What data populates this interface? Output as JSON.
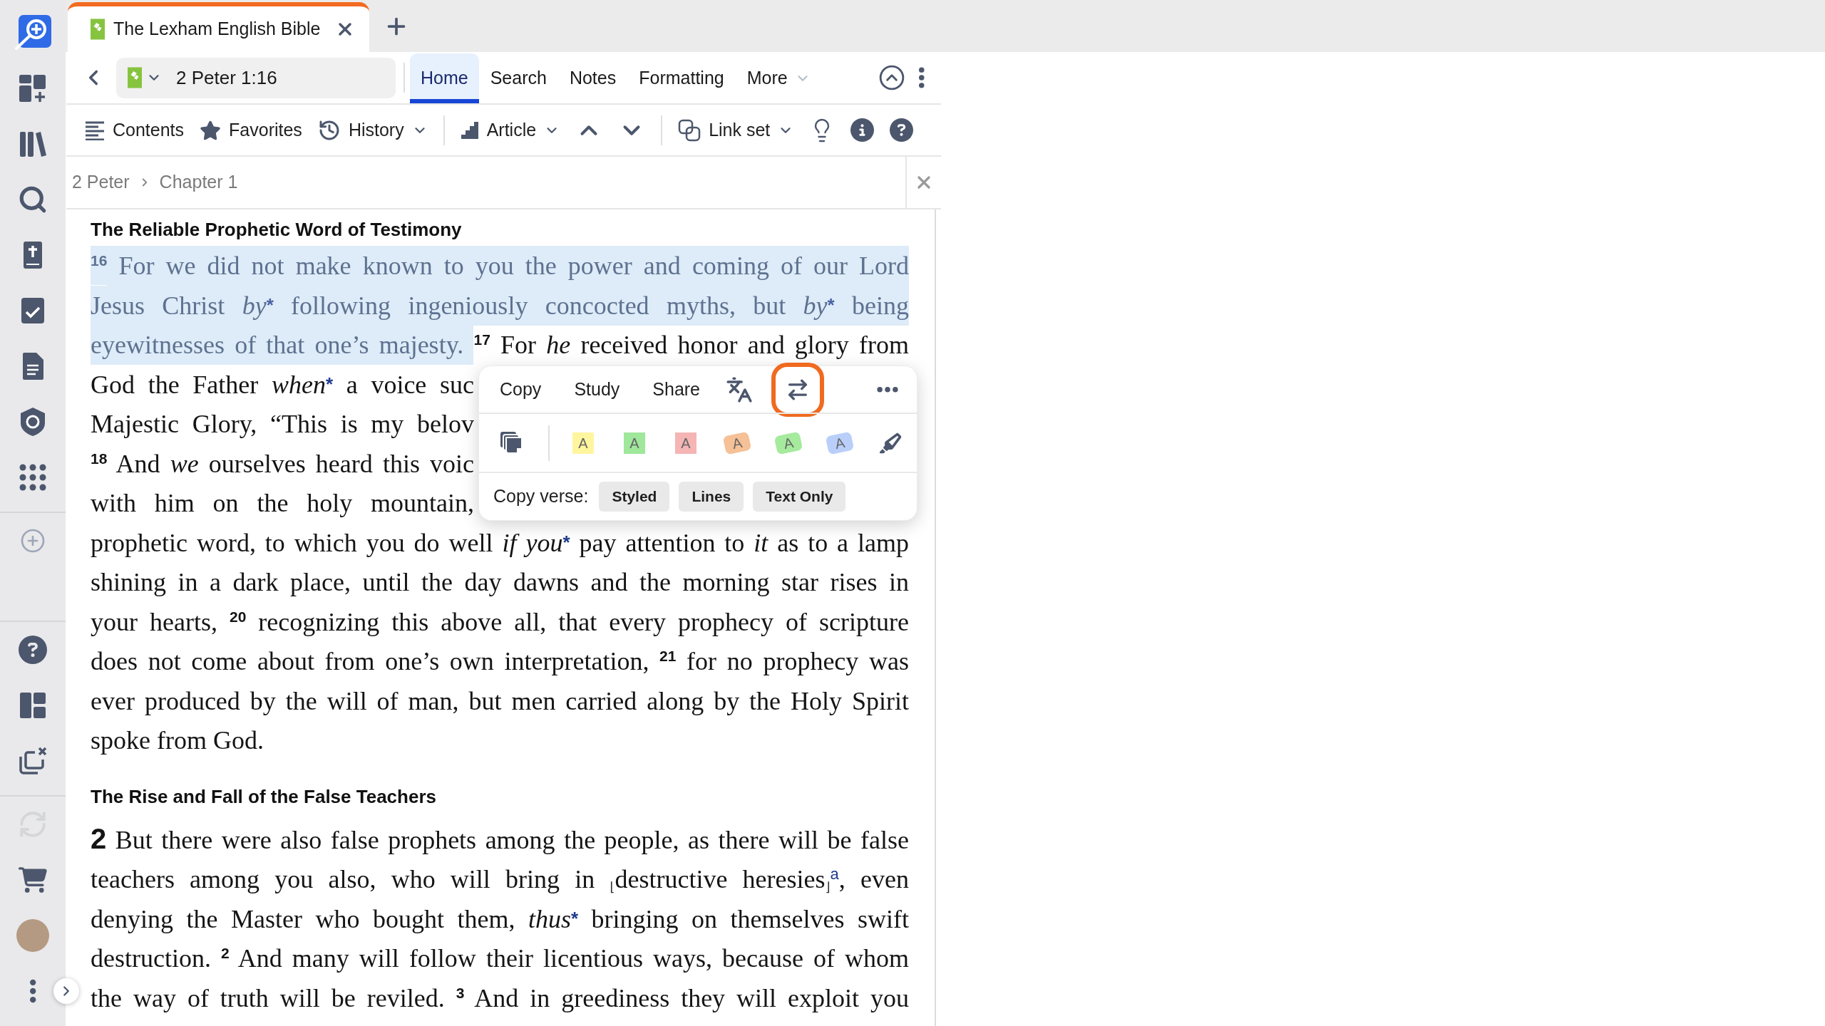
{
  "sidebar": {
    "groups": [
      {
        "items": [
          {
            "kind": "logo",
            "disabled": false
          },
          {
            "kind": "dashboard",
            "disabled": false
          },
          {
            "kind": "library",
            "disabled": false
          },
          {
            "kind": "search",
            "disabled": false
          },
          {
            "kind": "bible",
            "disabled": false
          },
          {
            "kind": "checklist",
            "disabled": false
          },
          {
            "kind": "document",
            "disabled": false
          },
          {
            "kind": "badge",
            "disabled": false
          },
          {
            "kind": "apps",
            "disabled": false
          }
        ]
      },
      {
        "items": [
          {
            "kind": "add",
            "disabled": false
          }
        ]
      },
      {
        "items": [
          {
            "kind": "help",
            "disabled": false
          },
          {
            "kind": "layout",
            "disabled": false
          },
          {
            "kind": "close_windows",
            "disabled": false
          }
        ]
      },
      {
        "items": [
          {
            "kind": "sync",
            "disabled": true
          },
          {
            "kind": "cart",
            "disabled": false
          },
          {
            "kind": "avatar",
            "disabled": false
          },
          {
            "kind": "more",
            "disabled": false
          }
        ]
      }
    ]
  },
  "tabs": [
    {
      "title": "The Lexham English Bible",
      "selected": true
    }
  ],
  "panel": {
    "reference": "2 Peter 1:16",
    "ribbon": [
      {
        "label": "Home",
        "selected": true,
        "has_menu": false
      },
      {
        "label": "Search",
        "selected": false,
        "has_menu": false
      },
      {
        "label": "Notes",
        "selected": false,
        "has_menu": false
      },
      {
        "label": "Formatting",
        "selected": false,
        "has_menu": false
      },
      {
        "label": "More",
        "selected": false,
        "has_menu": true
      }
    ],
    "toolbar": [
      {
        "kind": "contents",
        "label": "Contents",
        "has_menu": false
      },
      {
        "kind": "favorites",
        "label": "Favorites",
        "has_menu": false
      },
      {
        "kind": "history",
        "label": "History",
        "has_menu": true
      },
      {
        "kind": "divider"
      },
      {
        "kind": "article",
        "label": "Article",
        "has_menu": true
      },
      {
        "kind": "previous"
      },
      {
        "kind": "next"
      },
      {
        "kind": "divider"
      },
      {
        "kind": "link_set",
        "label": "Link set",
        "has_menu": true
      },
      {
        "kind": "insights"
      },
      {
        "kind": "info"
      },
      {
        "kind": "help"
      }
    ],
    "breadcrumb": [
      "2 Peter",
      "Chapter 1"
    ],
    "passage": {
      "sections": [
        {
          "heading": "The Reliable Prophetic Word of Testimony",
          "lines": [
            {
              "justified": true,
              "covered": false,
              "segments": [
                {
                  "kind": "verse",
                  "text": "16",
                  "selected": true
                },
                {
                  "kind": "text",
                  "text": " For we did not make known to you the power and coming of our Lord",
                  "selected": true
                }
              ]
            },
            {
              "justified": true,
              "covered": false,
              "segments": [
                {
                  "kind": "text",
                  "text": "Jesus Christ ",
                  "selected": true
                },
                {
                  "kind": "italic",
                  "text": "by",
                  "selected": true
                },
                {
                  "kind": "mark",
                  "text": "*",
                  "selected": true
                },
                {
                  "kind": "text",
                  "text": " following ingeniously concocted myths, but ",
                  "selected": true
                },
                {
                  "kind": "italic",
                  "text": "by",
                  "selected": true
                },
                {
                  "kind": "mark",
                  "text": "*",
                  "selected": true
                },
                {
                  "kind": "text",
                  "text": " being",
                  "selected": true
                }
              ]
            },
            {
              "justified": true,
              "covered": false,
              "segments": [
                {
                  "kind": "text",
                  "text": "eyewitnesses of that one’s majesty. ",
                  "selected": true
                },
                {
                  "kind": "verse",
                  "text": "17",
                  "selected": false
                },
                {
                  "kind": "text",
                  "text": " For ",
                  "selected": false
                },
                {
                  "kind": "italic",
                  "text": "he",
                  "selected": false
                },
                {
                  "kind": "text",
                  "text": " received honor and glory from",
                  "selected": false
                }
              ]
            },
            {
              "justified": true,
              "covered": true,
              "segments": [
                {
                  "kind": "text",
                  "text": "God the Father ",
                  "selected": false
                },
                {
                  "kind": "italic",
                  "text": "when",
                  "selected": false
                },
                {
                  "kind": "mark",
                  "text": "*",
                  "selected": false
                },
                {
                  "kind": "text",
                  "text": " a voice suc",
                  "selected": false
                }
              ]
            },
            {
              "justified": true,
              "covered": true,
              "segments": [
                {
                  "kind": "text",
                  "text": "Majestic Glory, “This is my belov",
                  "selected": false
                }
              ]
            },
            {
              "justified": true,
              "covered": true,
              "segments": [
                {
                  "kind": "verse",
                  "text": "18",
                  "selected": false
                },
                {
                  "kind": "text",
                  "text": " And ",
                  "selected": false
                },
                {
                  "kind": "italic",
                  "text": "we",
                  "selected": false
                },
                {
                  "kind": "text",
                  "text": " ourselves heard this voic",
                  "selected": false
                }
              ]
            },
            {
              "justified": true,
              "covered": true,
              "segments": [
                {
                  "kind": "text",
                  "text": "with him on the holy mountain,",
                  "selected": false
                }
              ]
            },
            {
              "justified": true,
              "covered": false,
              "segments": [
                {
                  "kind": "text",
                  "text": "prophetic word, to which you do well ",
                  "selected": false
                },
                {
                  "kind": "italic",
                  "text": "if you",
                  "selected": false
                },
                {
                  "kind": "mark",
                  "text": "*",
                  "selected": false
                },
                {
                  "kind": "text",
                  "text": " pay attention to ",
                  "selected": false
                },
                {
                  "kind": "italic",
                  "text": "it",
                  "selected": false
                },
                {
                  "kind": "text",
                  "text": " as to a lamp",
                  "selected": false
                }
              ]
            },
            {
              "justified": true,
              "covered": false,
              "segments": [
                {
                  "kind": "text",
                  "text": "shining in a dark place, until the day dawns and the morning star rises in",
                  "selected": false
                }
              ]
            },
            {
              "justified": true,
              "covered": false,
              "segments": [
                {
                  "kind": "text",
                  "text": "your hearts, ",
                  "selected": false
                },
                {
                  "kind": "verse",
                  "text": "20",
                  "selected": false
                },
                {
                  "kind": "text",
                  "text": " recognizing this above all, that every prophecy of scripture",
                  "selected": false
                }
              ]
            },
            {
              "justified": true,
              "covered": false,
              "segments": [
                {
                  "kind": "text",
                  "text": "does not come about from one’s own interpretation, ",
                  "selected": false
                },
                {
                  "kind": "verse",
                  "text": "21",
                  "selected": false
                },
                {
                  "kind": "text",
                  "text": " for no prophecy was",
                  "selected": false
                }
              ]
            },
            {
              "justified": true,
              "covered": false,
              "segments": [
                {
                  "kind": "text",
                  "text": "ever produced by the will of man, but men carried along by the Holy Spirit",
                  "selected": false
                }
              ]
            },
            {
              "justified": false,
              "covered": false,
              "segments": [
                {
                  "kind": "text",
                  "text": "spoke from God.",
                  "selected": false
                }
              ]
            }
          ]
        },
        {
          "heading": "The Rise and Fall of the False Teachers",
          "lines": [
            {
              "justified": true,
              "covered": false,
              "segments": [
                {
                  "kind": "chapter",
                  "text": "2",
                  "selected": false
                },
                {
                  "kind": "text",
                  "text": " But there were also false prophets among the people, as there will be false",
                  "selected": false
                }
              ]
            },
            {
              "justified": true,
              "covered": false,
              "segments": [
                {
                  "kind": "text",
                  "text": "teachers among you also, who will bring in ",
                  "selected": false
                },
                {
                  "kind": "bracket",
                  "text": "⌊",
                  "selected": false
                },
                {
                  "kind": "text",
                  "text": "destructive heresies",
                  "selected": false
                },
                {
                  "kind": "bracket",
                  "text": "⌋",
                  "selected": false
                },
                {
                  "kind": "footnote",
                  "text": "a",
                  "selected": false
                },
                {
                  "kind": "text",
                  "text": ", even",
                  "selected": false
                }
              ]
            },
            {
              "justified": true,
              "covered": false,
              "segments": [
                {
                  "kind": "text",
                  "text": "denying the Master who bought them, ",
                  "selected": false
                },
                {
                  "kind": "italic",
                  "text": "thus",
                  "selected": false
                },
                {
                  "kind": "mark",
                  "text": "*",
                  "selected": false
                },
                {
                  "kind": "text",
                  "text": " bringing on themselves swift",
                  "selected": false
                }
              ]
            },
            {
              "justified": true,
              "covered": false,
              "segments": [
                {
                  "kind": "text",
                  "text": "destruction. ",
                  "selected": false
                },
                {
                  "kind": "verse",
                  "text": "2",
                  "selected": false
                },
                {
                  "kind": "text",
                  "text": " And many will follow their licentious ways, because of whom",
                  "selected": false
                }
              ]
            },
            {
              "justified": true,
              "covered": false,
              "segments": [
                {
                  "kind": "text",
                  "text": "the way of truth will be reviled. ",
                  "selected": false
                },
                {
                  "kind": "verse",
                  "text": "3",
                  "selected": false
                },
                {
                  "kind": "text",
                  "text": " And in greediness they will exploit you",
                  "selected": false
                }
              ]
            }
          ]
        }
      ]
    },
    "selection_popup": {
      "actions": [
        {
          "kind": "text",
          "label": "Copy",
          "highlighted": false
        },
        {
          "kind": "text",
          "label": "Study",
          "highlighted": false
        },
        {
          "kind": "text",
          "label": "Share",
          "highlighted": false
        },
        {
          "kind": "translate",
          "highlighted": false
        },
        {
          "kind": "swap",
          "highlighted": true
        },
        {
          "kind": "more",
          "highlighted": false
        }
      ],
      "styles": [
        {
          "kind": "copy_styles"
        },
        {
          "kind": "divider"
        },
        {
          "kind": "square",
          "label": "A",
          "color": "#fff59e"
        },
        {
          "kind": "square",
          "label": "A",
          "color": "#9fe79b"
        },
        {
          "kind": "square",
          "label": "A",
          "color": "#f5b5b5"
        },
        {
          "kind": "brush",
          "label": "A",
          "color": "#f6c197"
        },
        {
          "kind": "brush",
          "label": "A",
          "color": "#a6ea9e"
        },
        {
          "kind": "brush",
          "label": "A",
          "color": "#b9cffa"
        },
        {
          "kind": "marker"
        }
      ],
      "copy_verse": {
        "label": "Copy verse:",
        "options": [
          "Styled",
          "Lines",
          "Text Only"
        ]
      }
    }
  }
}
